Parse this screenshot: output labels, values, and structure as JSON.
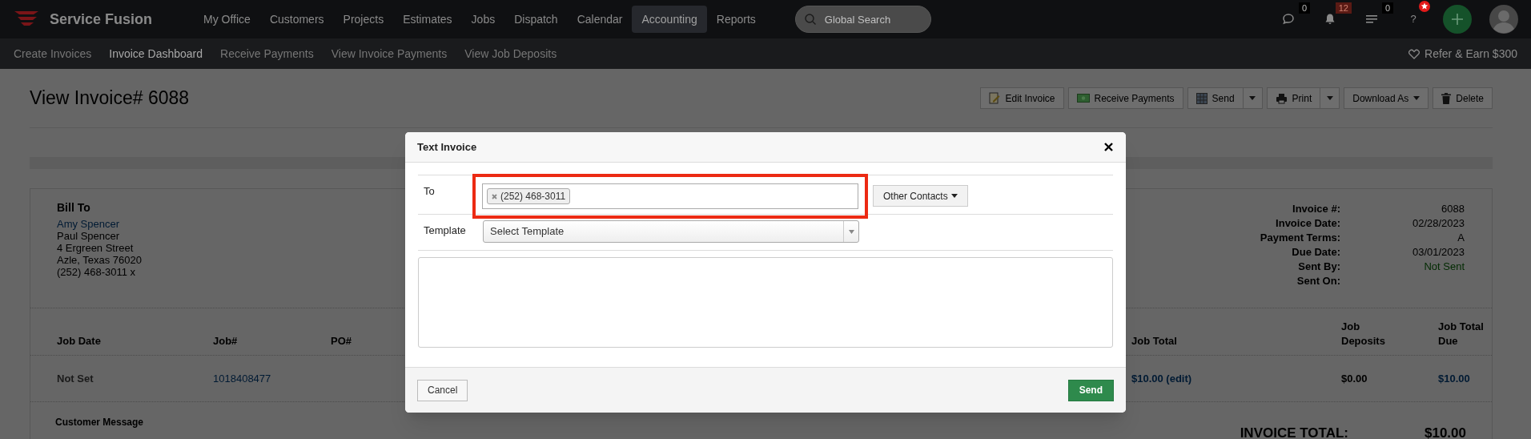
{
  "topbar": {
    "brand": "Service Fusion",
    "menu": [
      {
        "label": "My Office",
        "selected": false
      },
      {
        "label": "Customers",
        "selected": false
      },
      {
        "label": "Projects",
        "selected": false
      },
      {
        "label": "Estimates",
        "selected": false
      },
      {
        "label": "Jobs",
        "selected": false
      },
      {
        "label": "Dispatch",
        "selected": false
      },
      {
        "label": "Calendar",
        "selected": false
      },
      {
        "label": "Accounting",
        "selected": true
      },
      {
        "label": "Reports",
        "selected": false
      }
    ],
    "search": {
      "placeholder": "Global Search"
    },
    "indicators": [
      {
        "kind": "chat",
        "count": "0"
      },
      {
        "kind": "bell",
        "count": "12"
      },
      {
        "kind": "list",
        "count": "0"
      },
      {
        "kind": "help",
        "label": "?"
      }
    ]
  },
  "subnav": {
    "items": [
      {
        "label": "Create Invoices",
        "selected": false
      },
      {
        "label": "Invoice Dashboard",
        "selected": true
      },
      {
        "label": "Receive Payments",
        "selected": false
      },
      {
        "label": "View Invoice Payments",
        "selected": false
      },
      {
        "label": "View Job Deposits",
        "selected": false
      }
    ],
    "refer": "Refer & Earn $300"
  },
  "page": {
    "title": "View Invoice# 6088",
    "actions": [
      {
        "label": "Edit Invoice",
        "kind": "edit",
        "split": false
      },
      {
        "label": "Receive Payments",
        "kind": "money",
        "split": false
      },
      {
        "label": "Send",
        "kind": "send",
        "split": true
      },
      {
        "label": "Print",
        "kind": "print",
        "split": true
      },
      {
        "label": "Download As",
        "kind": "menu",
        "split": false
      },
      {
        "label": "Delete",
        "kind": "trash",
        "split": false
      }
    ]
  },
  "bill_to": {
    "heading": "Bill To",
    "name": "Amy Spencer",
    "lines": [
      "Paul Spencer",
      "4 Ergreen Street",
      "Azle, Texas 76020",
      "(252) 468-3011 x"
    ]
  },
  "invoice_meta": [
    {
      "label": "Invoice #:",
      "value": "6088",
      "kind": "text"
    },
    {
      "label": "Invoice Date:",
      "value": "02/28/2023",
      "kind": "text"
    },
    {
      "label": "Payment Terms:",
      "value": "A",
      "kind": "text"
    },
    {
      "label": "Due Date:",
      "value": "03/01/2023",
      "kind": "text"
    },
    {
      "label": "Sent By:",
      "value": "Not Sent",
      "kind": "status"
    },
    {
      "label": "Sent On:"
    }
  ],
  "jobs_table": {
    "columns": [
      "Job Date",
      "Job#",
      "PO#",
      "Job Total",
      "Job Deposits",
      "Job Total Due"
    ],
    "rows": [
      [
        {
          "text": "Not Set",
          "kind": "muted"
        },
        {
          "text": "1018408477",
          "kind": "link"
        },
        {
          "kind": "empty"
        },
        {
          "text": "$10.00 (edit)",
          "kind": "link"
        },
        {
          "text": "$0.00",
          "kind": "text"
        },
        {
          "text": "$10.00",
          "kind": "link"
        }
      ]
    ]
  },
  "customer_message": {
    "label": "Customer Message"
  },
  "invoice_total": {
    "label": "INVOICE TOTAL:",
    "value": "$10.00"
  },
  "modal": {
    "title": "Text Invoice",
    "to_label": "To",
    "highlighted": true,
    "recipients": [
      {
        "label": "(252) 468-3011"
      }
    ],
    "other_contacts": "Other Contacts",
    "template_label": "Template",
    "template_value": "Select Template",
    "cancel": "Cancel",
    "send": "Send"
  }
}
